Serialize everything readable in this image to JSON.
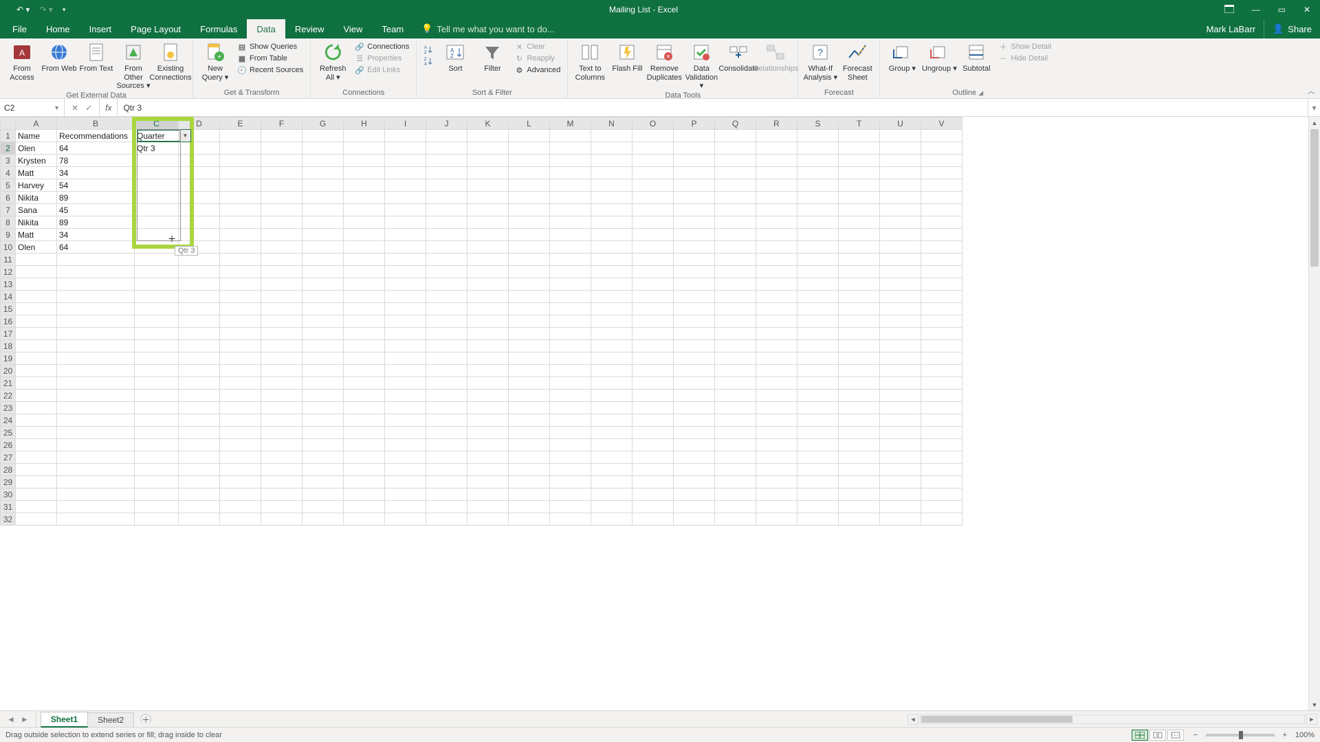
{
  "title": "Mailing List - Excel",
  "user": "Mark LaBarr",
  "share": "Share",
  "tell_me": "Tell me what you want to do...",
  "tabs": [
    "File",
    "Home",
    "Insert",
    "Page Layout",
    "Formulas",
    "Data",
    "Review",
    "View",
    "Team"
  ],
  "active_tab": "Data",
  "ribbon": {
    "get_external": {
      "label": "Get External Data",
      "from_access": "From Access",
      "from_web": "From Web",
      "from_text": "From Text",
      "from_other": "From Other Sources ▾",
      "existing": "Existing Connections"
    },
    "get_transform": {
      "label": "Get & Transform",
      "new_query": "New Query ▾",
      "show_queries": "Show Queries",
      "from_table": "From Table",
      "recent": "Recent Sources"
    },
    "connections": {
      "label": "Connections",
      "refresh": "Refresh All ▾",
      "connections": "Connections",
      "properties": "Properties",
      "edit_links": "Edit Links"
    },
    "sort_filter": {
      "label": "Sort & Filter",
      "sort": "Sort",
      "filter": "Filter",
      "clear": "Clear",
      "reapply": "Reapply",
      "advanced": "Advanced"
    },
    "data_tools": {
      "label": "Data Tools",
      "ttc": "Text to Columns",
      "flash": "Flash Fill",
      "dup": "Remove Duplicates",
      "valid": "Data Validation ▾",
      "consol": "Consolidate",
      "rel": "Relationships"
    },
    "forecast": {
      "label": "Forecast",
      "whatif": "What-If Analysis ▾",
      "sheet": "Forecast Sheet"
    },
    "outline": {
      "label": "Outline",
      "group": "Group ▾",
      "ungroup": "Ungroup ▾",
      "subtotal": "Subtotal",
      "show": "Show Detail",
      "hide": "Hide Detail"
    }
  },
  "namebox": "C2",
  "formula": "Qtr 3",
  "columns": [
    "A",
    "B",
    "C",
    "D",
    "E",
    "F",
    "G",
    "H",
    "I",
    "J",
    "K",
    "L",
    "M",
    "N",
    "O",
    "P",
    "Q",
    "R",
    "S",
    "T",
    "U",
    "V"
  ],
  "headers": {
    "A": "Name",
    "B": "Recommendations",
    "C": "Quarter"
  },
  "rows": [
    {
      "A": "Olen",
      "B": "64",
      "C": "Qtr 3"
    },
    {
      "A": "Krysten",
      "B": "78",
      "C": ""
    },
    {
      "A": "Matt",
      "B": "34",
      "C": ""
    },
    {
      "A": "Harvey",
      "B": "54",
      "C": ""
    },
    {
      "A": "Nikita",
      "B": "89",
      "C": ""
    },
    {
      "A": "Sana",
      "B": "45",
      "C": ""
    },
    {
      "A": "Nikita",
      "B": "89",
      "C": ""
    },
    {
      "A": "Matt",
      "B": "34",
      "C": ""
    },
    {
      "A": "Olen",
      "B": "64",
      "C": ""
    }
  ],
  "total_rows": 32,
  "drag_tooltip": "Qtr 3",
  "sheets": [
    "Sheet1",
    "Sheet2"
  ],
  "active_sheet": "Sheet1",
  "status": "Drag outside selection to extend series or fill; drag inside to clear",
  "zoom": "100%"
}
